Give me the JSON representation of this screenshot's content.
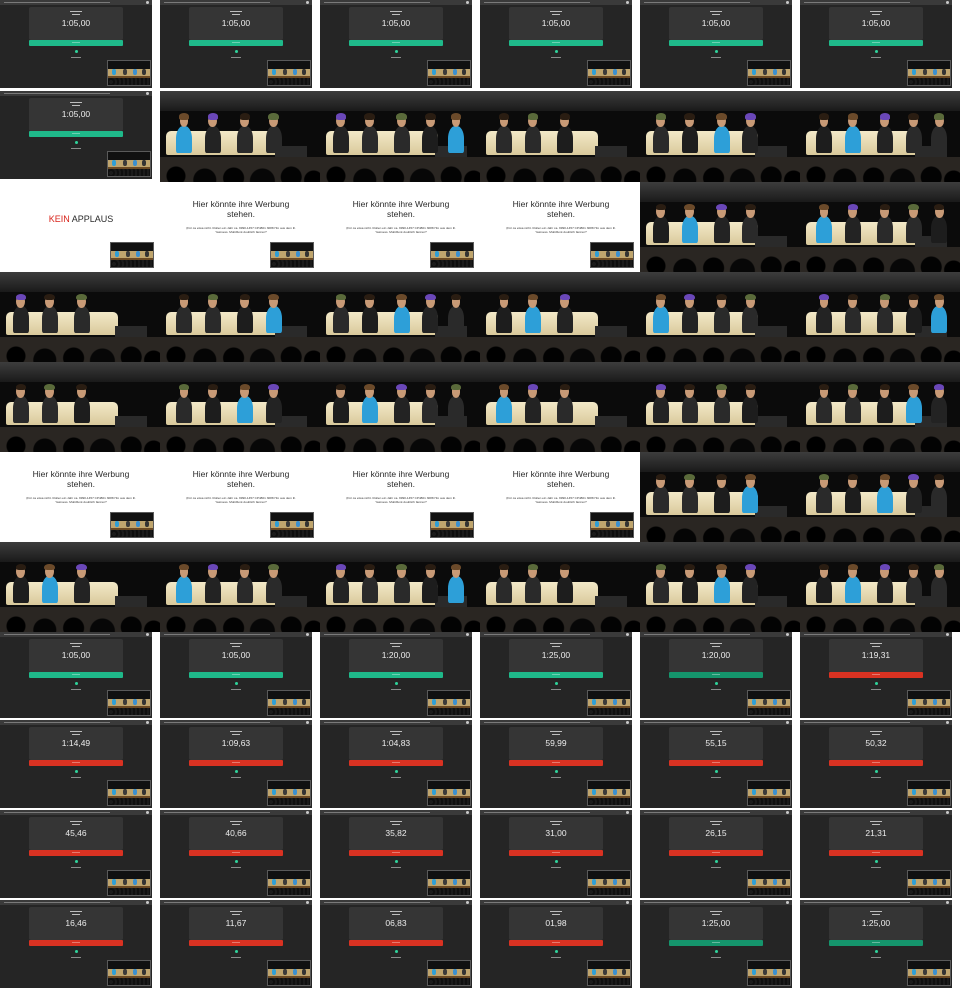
{
  "grid": {
    "columns": 6,
    "cells": [
      {
        "kind": "timer",
        "time": "1:05,00",
        "bar": "green"
      },
      {
        "kind": "timer",
        "time": "1:05,00",
        "bar": "green"
      },
      {
        "kind": "timer",
        "time": "1:05,00",
        "bar": "green"
      },
      {
        "kind": "timer",
        "time": "1:05,00",
        "bar": "green"
      },
      {
        "kind": "timer",
        "time": "1:05,00",
        "bar": "green"
      },
      {
        "kind": "timer",
        "time": "1:05,00",
        "bar": "green"
      },
      {
        "kind": "timer",
        "time": "1:05,00",
        "bar": "green"
      },
      {
        "kind": "stage"
      },
      {
        "kind": "stage"
      },
      {
        "kind": "stage"
      },
      {
        "kind": "stage"
      },
      {
        "kind": "stage"
      },
      {
        "kind": "slide-kein",
        "text_red": "KEIN",
        "text_dark": "APPLAUS"
      },
      {
        "kind": "slide",
        "title": "Hier könnte ihre Werbung stehen.",
        "sub": "(Für ca etwa nicht. Rollen ein Jahr ca. 9990-1457 CP4801 3088 Hm aus dem ill. Yasiness. Mobilfunk doublich fanzen?"
      },
      {
        "kind": "slide",
        "title": "Hier könnte ihre Werbung stehen.",
        "sub": "(Für ca etwa nicht. Rollen ein Jahr ca. 9990-1457 CP4801 3088 Hm aus dem ill. Yasiness. Mobilfunk doublich fanzen?"
      },
      {
        "kind": "slide",
        "title": "Hier könnte ihre Werbung stehen.",
        "sub": "(Für ca etwa nicht. Rollen ein Jahr ca. 9990-1457 CP4801 3088 Hm aus dem ill. Yasiness. Mobilfunk doublich fanzen?"
      },
      {
        "kind": "stage"
      },
      {
        "kind": "stage"
      },
      {
        "kind": "stage"
      },
      {
        "kind": "stage"
      },
      {
        "kind": "stage"
      },
      {
        "kind": "stage"
      },
      {
        "kind": "stage"
      },
      {
        "kind": "stage"
      },
      {
        "kind": "stage"
      },
      {
        "kind": "stage"
      },
      {
        "kind": "stage"
      },
      {
        "kind": "stage"
      },
      {
        "kind": "stage"
      },
      {
        "kind": "stage"
      },
      {
        "kind": "slide",
        "title": "Hier könnte ihre Werbung stehen.",
        "sub": "(Für ca etwa nicht. Rollen ein Jahr ca. 9990-1457 CP4801 3088 Hm aus dem ill. Yasiness. Mobilfunk doublich fanzen?"
      },
      {
        "kind": "slide",
        "title": "Hier könnte ihre Werbung stehen.",
        "sub": "(Für ca etwa nicht. Rollen ein Jahr ca. 9990-1457 CP4801 3088 Hm aus dem ill. Yasiness. Mobilfunk doublich fanzen?"
      },
      {
        "kind": "slide",
        "title": "Hier könnte ihre Werbung stehen.",
        "sub": "(Für ca etwa nicht. Rollen ein Jahr ca. 9990-1457 CP4801 3088 Hm aus dem ill. Yasiness. Mobilfunk doublich fanzen?"
      },
      {
        "kind": "slide",
        "title": "Hier könnte ihre Werbung stehen.",
        "sub": "(Für ca etwa nicht. Rollen ein Jahr ca. 9990-1457 CP4801 3088 Hm aus dem ill. Yasiness. Mobilfunk doublich fanzen?"
      },
      {
        "kind": "stage"
      },
      {
        "kind": "stage"
      },
      {
        "kind": "stage"
      },
      {
        "kind": "stage"
      },
      {
        "kind": "stage"
      },
      {
        "kind": "stage"
      },
      {
        "kind": "stage"
      },
      {
        "kind": "stage"
      },
      {
        "kind": "timer",
        "time": "1:05,00",
        "bar": "green"
      },
      {
        "kind": "timer",
        "time": "1:05,00",
        "bar": "green"
      },
      {
        "kind": "timer",
        "time": "1:20,00",
        "bar": "green"
      },
      {
        "kind": "timer",
        "time": "1:25,00",
        "bar": "green"
      },
      {
        "kind": "timer",
        "time": "1:20,00",
        "bar": "dgreen"
      },
      {
        "kind": "timer",
        "time": "1:19,31",
        "bar": "red"
      },
      {
        "kind": "timer",
        "time": "1:14,49",
        "bar": "red"
      },
      {
        "kind": "timer",
        "time": "1:09,63",
        "bar": "red"
      },
      {
        "kind": "timer",
        "time": "1:04,83",
        "bar": "red"
      },
      {
        "kind": "timer",
        "time": "59,99",
        "bar": "red"
      },
      {
        "kind": "timer",
        "time": "55,15",
        "bar": "red"
      },
      {
        "kind": "timer",
        "time": "50,32",
        "bar": "red"
      },
      {
        "kind": "timer",
        "time": "45,46",
        "bar": "red"
      },
      {
        "kind": "timer",
        "time": "40,66",
        "bar": "red"
      },
      {
        "kind": "timer",
        "time": "35,82",
        "bar": "red"
      },
      {
        "kind": "timer",
        "time": "31,00",
        "bar": "red"
      },
      {
        "kind": "timer",
        "time": "26,15",
        "bar": "red"
      },
      {
        "kind": "timer",
        "time": "21,31",
        "bar": "red"
      },
      {
        "kind": "timer",
        "time": "16,46",
        "bar": "red"
      },
      {
        "kind": "timer",
        "time": "11,67",
        "bar": "red"
      },
      {
        "kind": "timer",
        "time": "06,83",
        "bar": "red"
      },
      {
        "kind": "timer",
        "time": "01,98",
        "bar": "red"
      },
      {
        "kind": "timer",
        "time": "1:25,00",
        "bar": "dgreen"
      },
      {
        "kind": "timer",
        "time": "1:25,00",
        "bar": "dgreen"
      }
    ]
  },
  "colors": {
    "timer_bg": "#252525",
    "bar_green": "#1fb98a",
    "bar_dark_green": "#15956c",
    "bar_red": "#d93222",
    "slide_bg": "#ffffff",
    "kein_red": "#d8231a"
  }
}
